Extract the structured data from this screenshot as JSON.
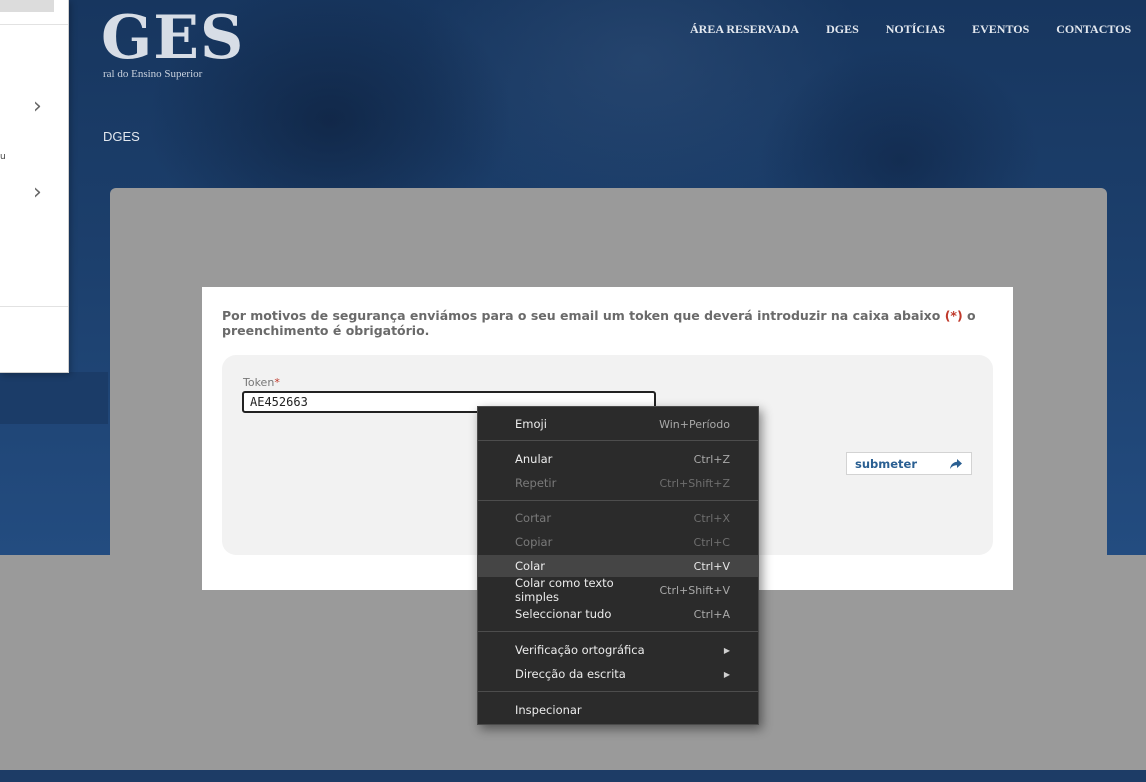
{
  "site": {
    "logo_text": "GES",
    "logo_subtitle": "ral do Ensino Superior",
    "breadcrumb": "DGES",
    "nav": [
      "ÁREA RESERVADA",
      "DGES",
      "NOTÍCIAS",
      "EVENTOS",
      "CONTACTOS"
    ]
  },
  "side_window": {
    "tiny_text": "u"
  },
  "form": {
    "message": "Por motivos de segurança enviámos para o seu email um token que deverá introduzir na caixa abaixo",
    "required_marker": "(*)",
    "message_end": "o preenchimento é obrigatório.",
    "token_label": "Token",
    "token_required": "*",
    "token_value": "AE452663",
    "submit_label": "submeter"
  },
  "context_menu": {
    "emoji": {
      "label": "Emoji",
      "shortcut": "Win+Período"
    },
    "undo": {
      "label": "Anular",
      "shortcut": "Ctrl+Z"
    },
    "redo": {
      "label": "Repetir",
      "shortcut": "Ctrl+Shift+Z"
    },
    "cut": {
      "label": "Cortar",
      "shortcut": "Ctrl+X"
    },
    "copy": {
      "label": "Copiar",
      "shortcut": "Ctrl+C"
    },
    "paste": {
      "label": "Colar",
      "shortcut": "Ctrl+V"
    },
    "paste_plain": {
      "label": "Colar como texto simples",
      "shortcut": "Ctrl+Shift+V"
    },
    "select_all": {
      "label": "Seleccionar tudo",
      "shortcut": "Ctrl+A"
    },
    "spellcheck": {
      "label": "Verificação ortográfica"
    },
    "writing_direction": {
      "label": "Direcção da escrita"
    },
    "inspect": {
      "label": "Inspecionar"
    }
  },
  "colors": {
    "hero_blue": "#1c3f6c",
    "panel_gray": "#9a9a9a",
    "menu_bg": "#2b2b2b",
    "link_blue": "#2a5f92",
    "required_red": "#c0392b"
  }
}
